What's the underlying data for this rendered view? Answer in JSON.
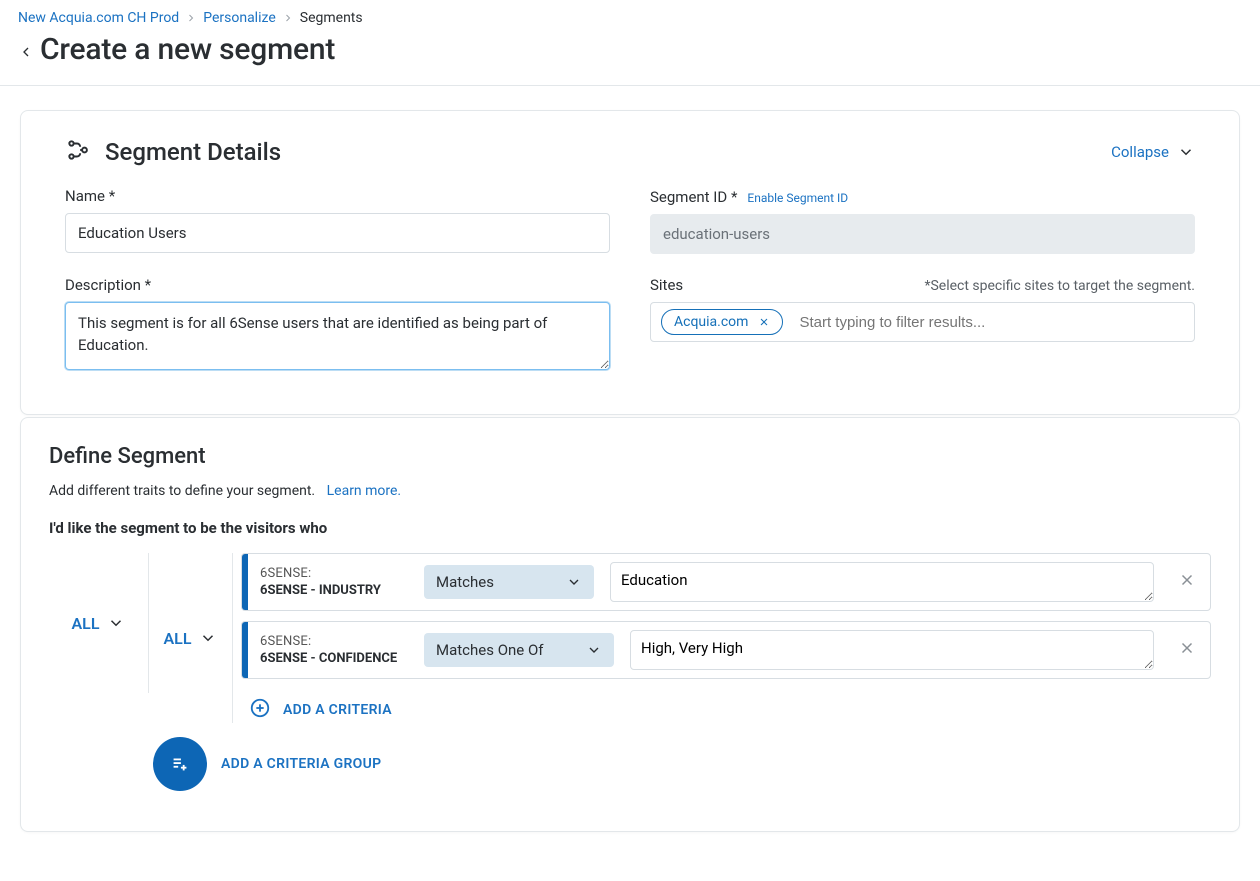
{
  "breadcrumb": {
    "items": [
      {
        "label": "New Acquia.com CH Prod",
        "link": true
      },
      {
        "label": "Personalize",
        "link": true
      },
      {
        "label": "Segments",
        "link": false
      }
    ]
  },
  "page": {
    "title": "Create a new segment"
  },
  "details": {
    "card_title": "Segment Details",
    "collapse_label": "Collapse",
    "name_label": "Name *",
    "name_value": "Education Users",
    "segment_id_label": "Segment ID *",
    "enable_id_label": "Enable Segment ID",
    "segment_id_value": "education-users",
    "description_label": "Description *",
    "description_value": "This segment is for all 6Sense users that are identified as being part of Education.",
    "sites_label": "Sites",
    "sites_hint": "*Select specific sites to target the segment.",
    "sites_chip": "Acquia.com",
    "sites_placeholder": "Start typing to filter results..."
  },
  "define": {
    "title": "Define Segment",
    "subtitle": "Add different traits to define your segment.",
    "learn_more": "Learn more.",
    "lead": "I'd like the segment to be the visitors who",
    "outer_op": "ALL",
    "inner_op": "ALL",
    "rules": [
      {
        "source": "6SENSE:",
        "attribute": "6SENSE - INDUSTRY",
        "operator": "Matches",
        "value": "Education"
      },
      {
        "source": "6SENSE:",
        "attribute": "6SENSE - CONFIDENCE",
        "operator": "Matches One Of",
        "value": "High, Very High"
      }
    ],
    "add_criteria": "ADD A CRITERIA",
    "add_group": "ADD A CRITERIA GROUP"
  }
}
